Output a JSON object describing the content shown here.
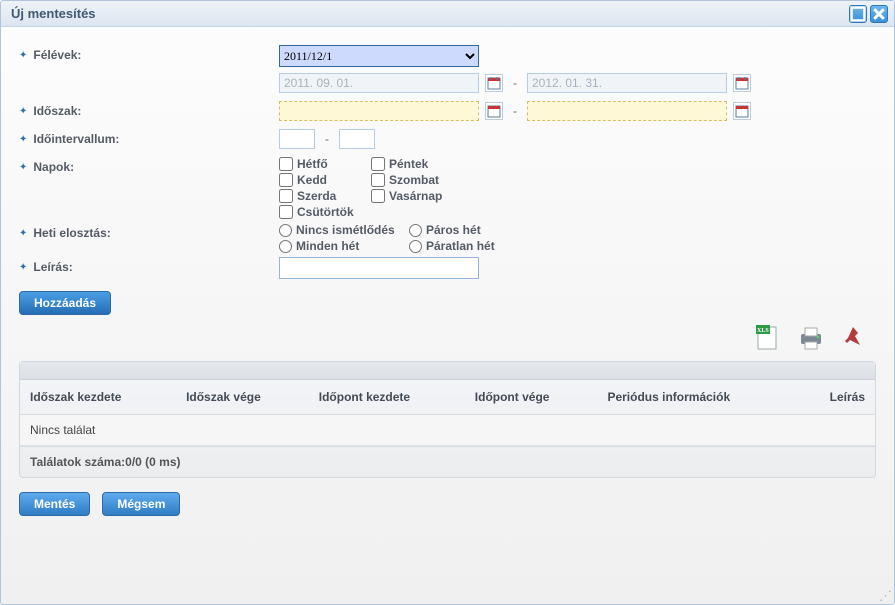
{
  "window": {
    "title": "Új mentesítés"
  },
  "labels": {
    "semesters": "Félévek:",
    "period": "Időszak:",
    "interval": "Időintervallum:",
    "days": "Napok:",
    "weekly": "Heti elosztás:",
    "description": "Leírás:"
  },
  "semester_select": {
    "value": "2011/12/1"
  },
  "dates": {
    "start_ro": "2011. 09. 01.",
    "end_ro": "2012. 01. 31.",
    "dash": "-"
  },
  "days": {
    "mon": "Hétfő",
    "tue": "Kedd",
    "wed": "Szerda",
    "thu": "Csütörtök",
    "fri": "Péntek",
    "sat": "Szombat",
    "sun": "Vasárnap"
  },
  "weekly": {
    "none": "Nincs ismétlődés",
    "every": "Minden hét",
    "even": "Páros hét",
    "odd": "Páratlan hét"
  },
  "buttons": {
    "add": "Hozzáadás",
    "save": "Mentés",
    "cancel": "Mégsem"
  },
  "grid": {
    "headers": {
      "period_start": "Időszak kezdete",
      "period_end": "Időszak vége",
      "time_start": "Időpont kezdete",
      "time_end": "Időpont vége",
      "period_info": "Periódus információk",
      "desc": "Leírás"
    },
    "empty_text": "Nincs találat",
    "footer": "Találatok száma:0/0 (0 ms)"
  }
}
